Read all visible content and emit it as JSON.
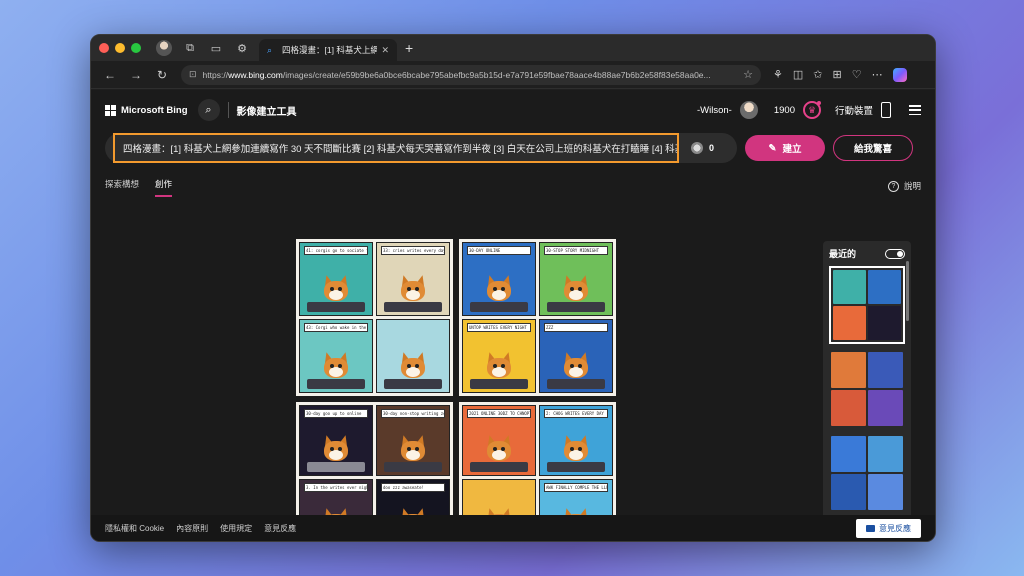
{
  "browser": {
    "tab_title": "四格漫畫：[1] 科基犬上網參加細",
    "url_prefix": "https://",
    "url_host": "www.bing.com",
    "url_path": "/images/create/e59b9be6a0bce6bcabe795abefbc9a5b15d-e7a791e59fbae78aace4b88ae7b6b2e58f83e58aa0e...",
    "new_tab_symbol": "+"
  },
  "header": {
    "brand": "Microsoft Bing",
    "tool_title": "影像建立工具",
    "user_name": "-Wilson-",
    "points": "1900",
    "mobile_label": "行動裝置"
  },
  "prompt": {
    "text": "四格漫畫：[1] 科基犬上網參加連續寫作 30 天不間斷比賽 [2] 科基犬每天哭著寫作到半夜 [3] 白天在公司上班的科基犬在打瞌睡 [4] 科基",
    "boost_count": "0",
    "create_label": "建立",
    "surprise_label": "給我驚喜"
  },
  "subnav": {
    "explore": "探索構想",
    "creations": "創作",
    "help": "說明"
  },
  "comics": [
    {
      "captions": [
        "41: corgis go to sociate to non-stop writing contest",
        "33: cries writes every day",
        "43: Corgi who wake in the armany dozes off",
        ""
      ]
    },
    {
      "captions": [
        "30-DAY ONLINE",
        "30-STOP STORY MIDNIGHT",
        "UNTOP WRITES EVERY NIGHT",
        "ZZZ"
      ]
    },
    {
      "captions": [
        "30-day goo up to online",
        "30-day non-stop writing zonertrsde!",
        "3. In the writes ever night",
        "doo zzz awaseate!"
      ]
    },
    {
      "captions": [
        "2021 ONLINE 30DZ TO CHNOPTER 30 NON-STOP WRITIENG CONTEST",
        "2: CHOG WRITES EVERY DAY",
        "",
        "AWK FINALLY COMPLE THE LLEPPW"
      ]
    }
  ],
  "recent": {
    "title": "最近的"
  },
  "footer": {
    "privacy": "隱私權和 Cookie",
    "content_policy": "內容原則",
    "terms": "使用規定",
    "feedback": "意見反應",
    "feedback_button": "意見反應"
  },
  "colors": {
    "accent": "#d1357f",
    "highlight": "#f39a2e"
  }
}
